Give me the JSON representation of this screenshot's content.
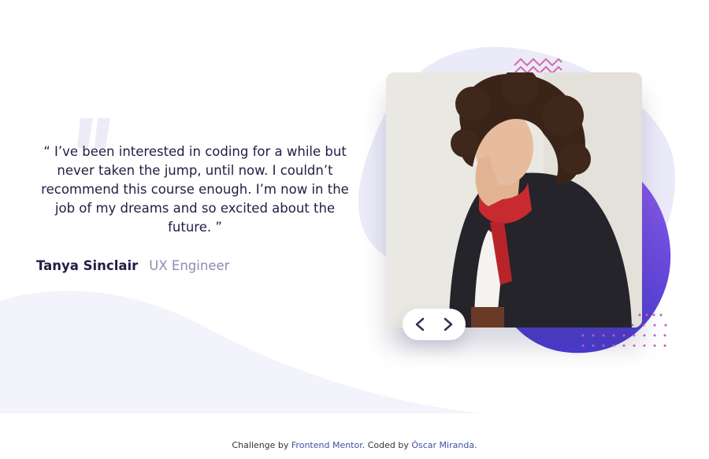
{
  "testimonial": {
    "quote": "“ I’ve been interested in coding for a while but never taken the jump, until now. I couldn’t recommend this course enough. I’m now in the job of my dreams and so excited about the future. ”",
    "author_name": "Tanya Sinclair",
    "author_role": "UX Engineer"
  },
  "navigation": {
    "prev_icon": "chevron-left-icon",
    "next_icon": "chevron-right-icon"
  },
  "attribution": {
    "prefix": "Challenge by ",
    "link1": "Frontend Mentor",
    "middle": ". Coded by ",
    "link2": "Óscar Miranda",
    "suffix": "."
  },
  "colors": {
    "text_dark": "#202046",
    "text_muted": "#8c8cb0",
    "curve_bg": "#f3f3fc",
    "blob_light": "#eaeaf8",
    "blob_purple": "#5a3ed0",
    "link": "#3e52a3"
  }
}
